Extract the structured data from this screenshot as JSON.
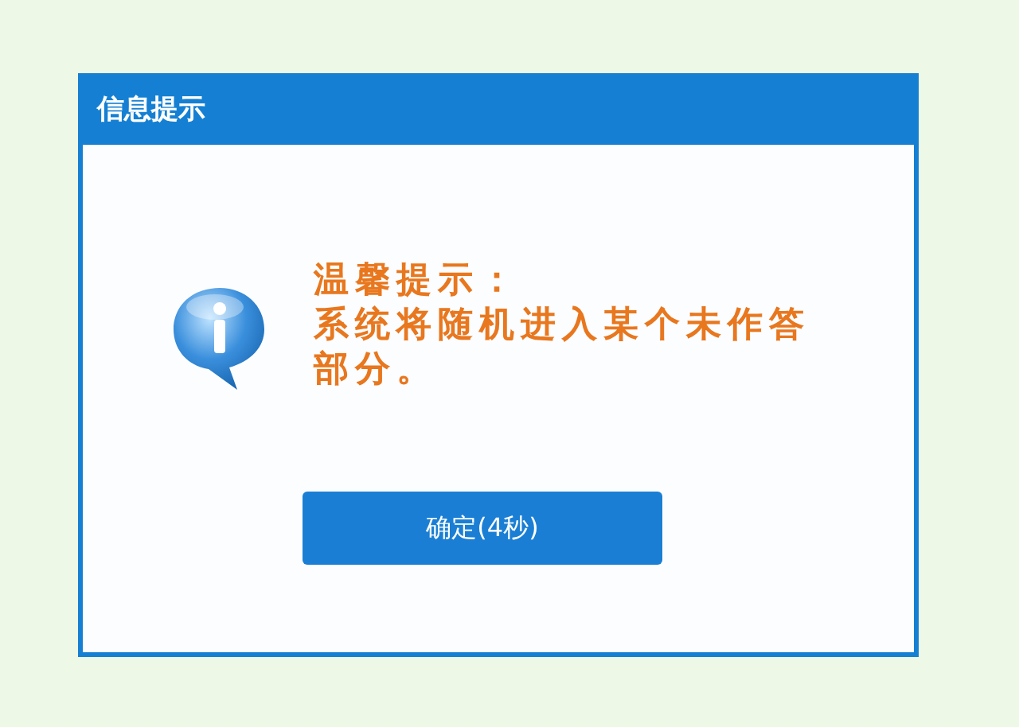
{
  "dialog": {
    "title": "信息提示",
    "heading": "温馨提示：",
    "message": "系统将随机进入某个未作答部分。",
    "buttons": [
      {
        "label": "确定(4秒)",
        "kind": "primary"
      }
    ]
  }
}
